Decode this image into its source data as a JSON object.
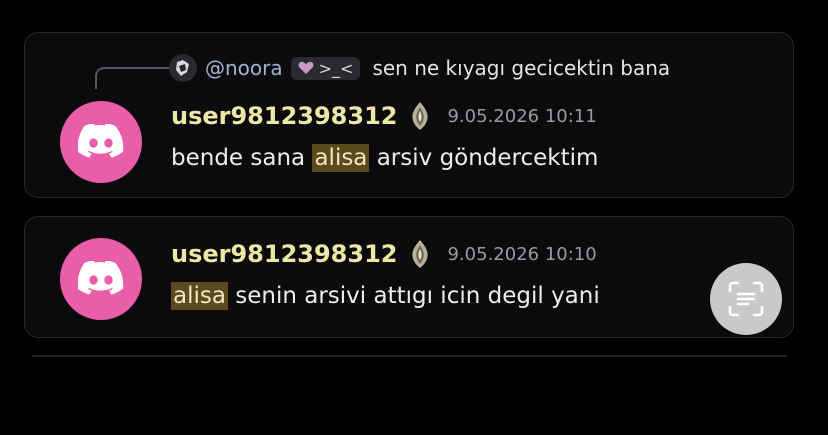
{
  "reply": {
    "username": "@noora",
    "tag_text": ">_<",
    "text": "sen ne kıyagı gecicektin bana"
  },
  "messages": [
    {
      "username": "user9812398312",
      "timestamp": "9.05.2026 10:11",
      "text_highlight": "alisa",
      "text_before": "bende sana ",
      "text_after": " arsiv göndercektim"
    },
    {
      "username": "user9812398312",
      "timestamp": "9.05.2026 10:10",
      "text_highlight": "alisa",
      "text_before": "",
      "text_after": " senin arsivi attıgı icin degil yani"
    }
  ],
  "colors": {
    "avatar_bg": "#ea5da8",
    "username": "#eee8a6",
    "highlight_bg": "#5a4a1e",
    "reply_user": "#9fb4d4"
  },
  "icons": {
    "avatar": "discord-logo-icon",
    "badge": "leaf-badge-icon",
    "tag": "heart-icon",
    "lens": "visual-lookup-icon"
  }
}
